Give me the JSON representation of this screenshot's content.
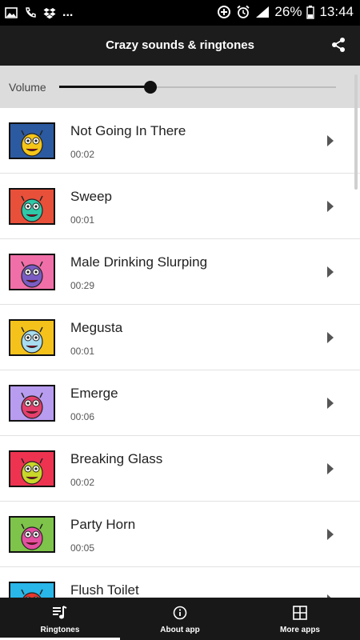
{
  "status_bar": {
    "more_indicator": "...",
    "battery": "26%",
    "time": "13:44"
  },
  "app_bar": {
    "title": "Crazy sounds & ringtones"
  },
  "volume": {
    "label": "Volume",
    "level": 0.33
  },
  "sounds": [
    {
      "title": "Not Going In There",
      "duration": "00:02",
      "bg": "#2c5aa0",
      "monster": "#f5c518"
    },
    {
      "title": "Sweep",
      "duration": "00:01",
      "bg": "#e8503a",
      "monster": "#2fc9a8"
    },
    {
      "title": "Male Drinking Slurping",
      "duration": "00:29",
      "bg": "#f06fa8",
      "monster": "#7b5cc4"
    },
    {
      "title": "Megusta",
      "duration": "00:01",
      "bg": "#f4c21b",
      "monster": "#a8dcef"
    },
    {
      "title": "Emerge",
      "duration": "00:06",
      "bg": "#b89cef",
      "monster": "#e53f6c"
    },
    {
      "title": "Breaking Glass",
      "duration": "00:02",
      "bg": "#ee3350",
      "monster": "#c9d62a"
    },
    {
      "title": "Party Horn",
      "duration": "00:05",
      "bg": "#7ec34a",
      "monster": "#e44fa0"
    },
    {
      "title": "Flush Toilet",
      "duration": "",
      "bg": "#29b6e8",
      "monster": "#e5372f"
    }
  ],
  "tabs": [
    {
      "label": "Ringtones",
      "icon": "music-list-icon",
      "selected": true
    },
    {
      "label": "About app",
      "icon": "info-icon",
      "selected": false
    },
    {
      "label": "More apps",
      "icon": "grid-icon",
      "selected": false
    }
  ]
}
